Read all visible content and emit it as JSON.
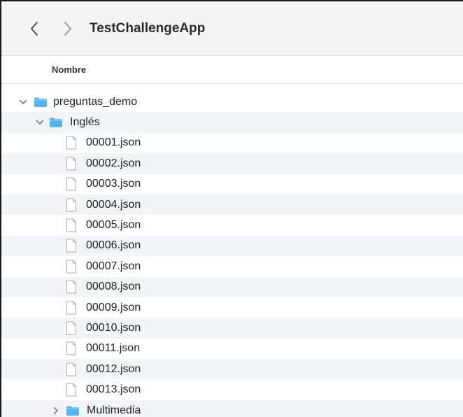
{
  "window": {
    "title": "TestChallengeApp"
  },
  "toolbar": {
    "back_icon": "chevron-left-icon",
    "forward_icon": "chevron-right-icon"
  },
  "columns": {
    "name_header": "Nombre"
  },
  "tree": {
    "root_folder": {
      "label": "preguntas_demo",
      "expanded": true
    },
    "subfolder": {
      "label": "Inglés",
      "expanded": true
    },
    "files": [
      "00001.json",
      "00002.json",
      "00003.json",
      "00004.json",
      "00005.json",
      "00006.json",
      "00007.json",
      "00008.json",
      "00009.json",
      "00010.json",
      "00011.json",
      "00012.json",
      "00013.json"
    ],
    "collapsed_folder": {
      "label": "Multimedia",
      "expanded": false
    }
  },
  "colors": {
    "folder_blue": "#5ab4ec",
    "stripe": "#f2f5f8",
    "toolbar_bg": "#f5f5f5"
  }
}
